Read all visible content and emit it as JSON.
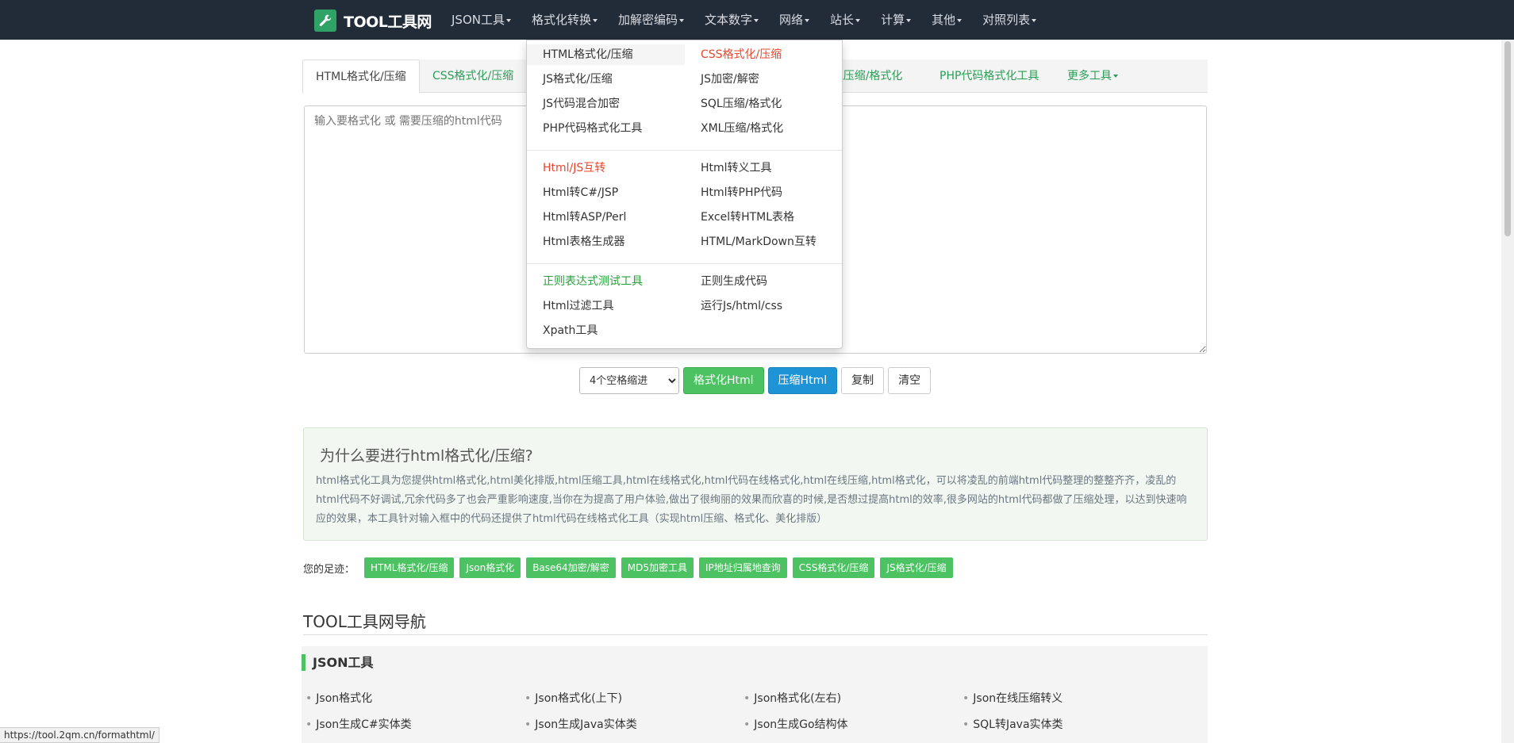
{
  "navbar": {
    "brand": "TOOL工具网",
    "menu": [
      "JSON工具",
      "格式化转换",
      "加解密编码",
      "文本数字",
      "网络",
      "站长",
      "计算",
      "其他",
      "对照列表"
    ]
  },
  "tabs": [
    "HTML格式化/压缩",
    "CSS格式化/压缩",
    "SQL压缩/格式化",
    "PHP代码格式化工具",
    "更多工具"
  ],
  "editor": {
    "placeholder": "输入要格式化 或 需要压缩的html代码"
  },
  "toolbar": {
    "indent_selected": "4个空格缩进",
    "format_button": "格式化Html",
    "compress_button": "压缩Html",
    "copy_button": "复制",
    "clear_button": "清空"
  },
  "info": {
    "title": "为什么要进行html格式化/压缩?",
    "body": "html格式化工具为您提供html格式化,html美化排版,html压缩工具,html在线格式化,html代码在线格式化,html在线压缩,html格式化，可以将凌乱的前端html代码整理的整整齐齐，凌乱的html代码不好调试,冗余代码多了也会严重影响速度,当你在为提高了用户体验,做出了很绚丽的效果而欣喜的时候,是否想过提高html的效率,很多网站的html代码都做了压缩处理，以达到快速响应的效果，本工具针对输入框中的代码还提供了html代码在线格式化工具（实现html压缩、格式化、美化排版）"
  },
  "footprints": {
    "label": "您的足迹：",
    "tags": [
      "HTML格式化/压缩",
      "Json格式化",
      "Base64加密/解密",
      "MD5加密工具",
      "IP地址归属地查询",
      "CSS格式化/压缩",
      "JS格式化/压缩"
    ]
  },
  "site_nav": {
    "title": "TOOL工具网导航",
    "json_section": {
      "title": "JSON工具",
      "items": [
        "Json格式化",
        "Json格式化(上下)",
        "Json格式化(左右)",
        "Json在线压缩转义",
        "Json生成C#实体类",
        "Json生成Java实体类",
        "Json生成Go结构体",
        "SQL转Java实体类"
      ]
    }
  },
  "dropdown": {
    "group1": {
      "left": [
        "HTML格式化/压缩",
        "JS格式化/压缩",
        "JS代码混合加密",
        "PHP代码格式化工具"
      ],
      "right": [
        "CSS格式化/压缩",
        "JS加密/解密",
        "SQL压缩/格式化",
        "XML压缩/格式化"
      ]
    },
    "group2": {
      "left": [
        "Html/JS互转",
        "Html转C#/JSP",
        "Html转ASP/Perl",
        "Html表格生成器"
      ],
      "right": [
        "Html转义工具",
        "Html转PHP代码",
        "Excel转HTML表格",
        "HTML/MarkDown互转"
      ]
    },
    "group3": {
      "left": [
        "正则表达式测试工具",
        "Html过滤工具",
        "Xpath工具"
      ],
      "right": [
        "正则生成代码",
        "运行Js/html/css"
      ]
    }
  },
  "status_url": "https://tool.2qm.cn/formathtml/",
  "colors": {
    "navbar_bg": "#222b38",
    "brand_green": "#2fa366",
    "accent_green": "#4cc263",
    "accent_blue": "#1e94d6",
    "highlight_red": "#e8462e"
  }
}
